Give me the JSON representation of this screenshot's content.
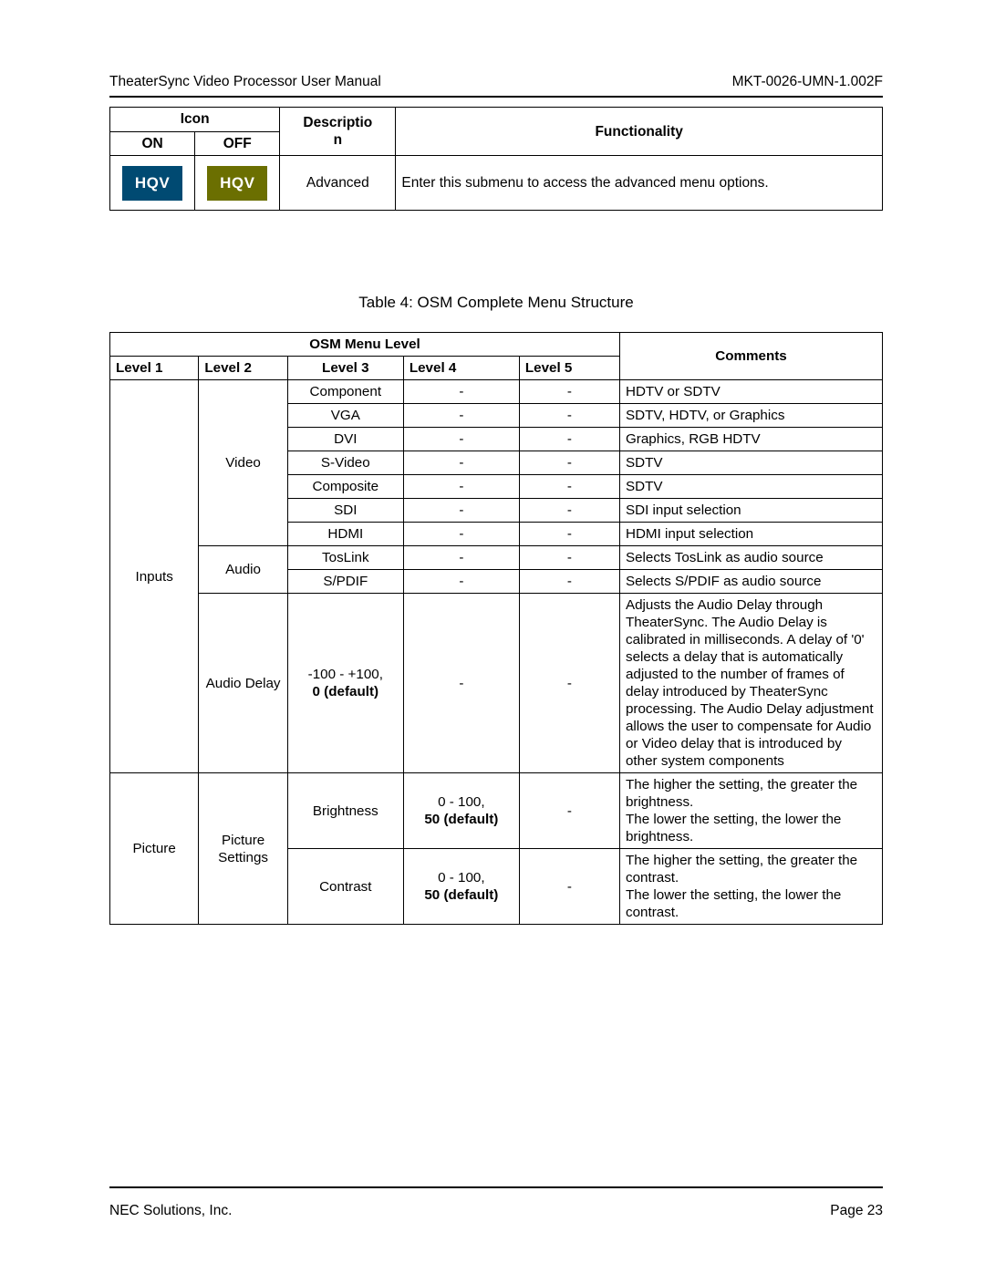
{
  "header": {
    "left": "TheaterSync Video Processor User Manual",
    "right": "MKT-0026-UMN-1.002F"
  },
  "footer": {
    "left": "NEC Solutions, Inc.",
    "right": "Page 23"
  },
  "table1": {
    "head": {
      "icon": "Icon",
      "on": "ON",
      "off": "OFF",
      "description": "Descriptio",
      "description2": "n",
      "functionality": "Functionality"
    },
    "row": {
      "on_icon_text": "HQV",
      "off_icon_text": "HQV",
      "description": "Advanced",
      "functionality": "Enter this submenu to access the advanced menu options."
    }
  },
  "table2_caption": "Table 4: OSM Complete Menu Structure",
  "table2": {
    "head": {
      "osm_menu_level": "OSM Menu Level",
      "comments": "Comments",
      "level1": "Level 1",
      "level2": "Level 2",
      "level3": "Level 3",
      "level4": "Level 4",
      "level5": "Level 5"
    },
    "groups": [
      {
        "level1": "Inputs",
        "subgroups": [
          {
            "level2": "Video",
            "rows": [
              {
                "level3": "Component",
                "level4": "-",
                "level5": "-",
                "comments": "HDTV or SDTV"
              },
              {
                "level3": "VGA",
                "level4": "-",
                "level5": "-",
                "comments": "SDTV, HDTV, or Graphics"
              },
              {
                "level3": "DVI",
                "level4": "-",
                "level5": "-",
                "comments": "Graphics, RGB HDTV"
              },
              {
                "level3": "S-Video",
                "level4": "-",
                "level5": "-",
                "comments": "SDTV"
              },
              {
                "level3": "Composite",
                "level4": "-",
                "level5": "-",
                "comments": "SDTV"
              },
              {
                "level3": "SDI",
                "level4": "-",
                "level5": "-",
                "comments": "SDI input selection"
              },
              {
                "level3": "HDMI",
                "level4": "-",
                "level5": "-",
                "comments": "HDMI input selection"
              }
            ]
          },
          {
            "level2": "Audio",
            "rows": [
              {
                "level3": "TosLink",
                "level4": "-",
                "level5": "-",
                "comments": "Selects TosLink as audio source"
              },
              {
                "level3": "S/PDIF",
                "level4": "-",
                "level5": "-",
                "comments": "Selects S/PDIF as audio source"
              }
            ]
          },
          {
            "level2": "Audio Delay",
            "rows": [
              {
                "level3": "-100 - +100,",
                "level3_bold": "0 (default)",
                "level4": "-",
                "level5": "-",
                "comments": "Adjusts the Audio Delay through TheaterSync. The Audio Delay is calibrated in milliseconds. A delay of '0' selects a delay that is automatically adjusted to the number of frames of delay introduced by TheaterSync processing. The Audio Delay adjustment allows the user to compensate for Audio or Video delay that is introduced by other system components"
              }
            ]
          }
        ]
      },
      {
        "level1": "Picture",
        "subgroups": [
          {
            "level2": "Picture Settings",
            "rows": [
              {
                "level3": "Brightness",
                "level4": "0 - 100,",
                "level4_bold": "50 (default)",
                "level5": "-",
                "comments": "The higher the setting, the greater the brightness.\nThe lower the setting, the lower the brightness."
              },
              {
                "level3": "Contrast",
                "level4": "0 - 100,",
                "level4_bold": "50 (default)",
                "level5": "-",
                "comments": "The higher the setting, the greater the contrast.\nThe lower the setting, the lower the contrast."
              }
            ]
          }
        ]
      }
    ]
  }
}
